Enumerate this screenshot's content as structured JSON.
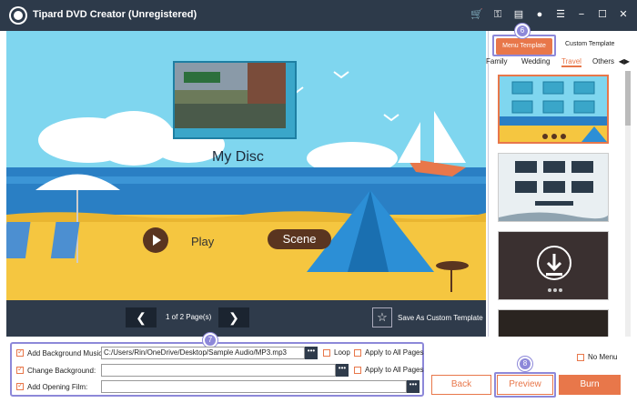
{
  "window": {
    "title": "Tipard DVD Creator (Unregistered)"
  },
  "titlebar_icons": [
    "cart-icon",
    "key-icon",
    "file-icon",
    "chat-icon",
    "menu-icon",
    "minimize-icon",
    "maximize-icon",
    "close-icon"
  ],
  "preview": {
    "disc_title": "My Disc",
    "play_label": "Play",
    "scene_label": "Scene"
  },
  "navbar": {
    "prev_symbol": "❮",
    "next_symbol": "❯",
    "page_count": "1 of 2 Page(s)",
    "save_template_label": "Save As Custom Template"
  },
  "sidebar": {
    "menu_template_tab": "Menu Template",
    "custom_template_tab": "Custom Template",
    "badge_6": "6",
    "categories": [
      "Family",
      "Wedding",
      "Travel",
      "Others"
    ],
    "active_category": "Travel"
  },
  "bottom": {
    "badge_7": "7",
    "badge_8": "8",
    "add_bg_music_label": "Add Background Music:",
    "bg_music_path": "C:/Users/Rin/OneDrive/Desktop/Sample Audio/MP3.mp3",
    "loop_label": "Loop",
    "apply_all_label": "Apply to All Pages",
    "change_bg_label": "Change Background:",
    "change_bg_value": "",
    "apply_all_label_2": "Apply to All Pages",
    "add_opening_film_label": "Add Opening Film:",
    "opening_film_value": "",
    "dots": "•••",
    "no_menu_label": "No Menu",
    "back_label": "Back",
    "preview_label": "Preview",
    "burn_label": "Burn"
  },
  "colors": {
    "accent": "#e8774a",
    "dark": "#2d3a4a",
    "highlight": "#8d88d9"
  }
}
